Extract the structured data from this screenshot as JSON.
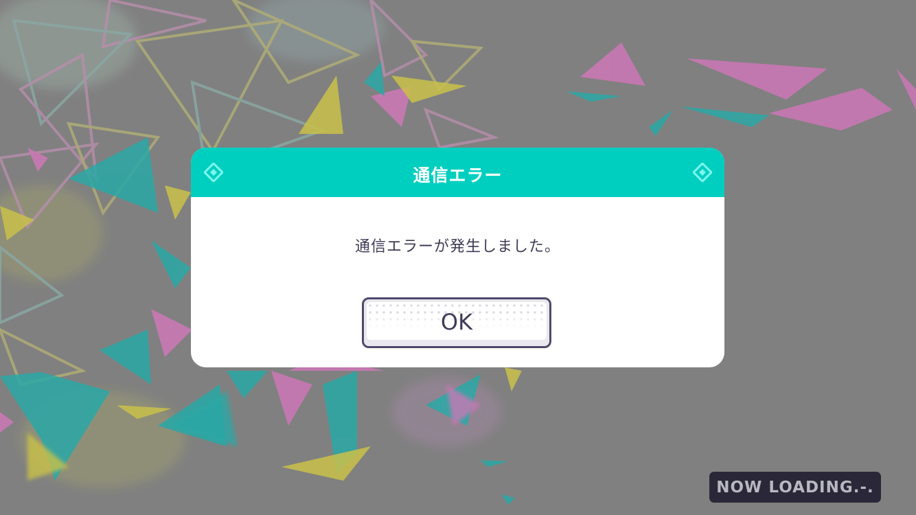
{
  "dialog": {
    "title": "通信エラー",
    "message": "通信エラーが発生しました。",
    "ok_label": "OK"
  },
  "loading": {
    "text": "NOW LOADING.-."
  },
  "colors": {
    "header": "#00cfc0",
    "dialog_text": "#3f3a55",
    "button_border": "#4e4a6a",
    "background_overlay": "#808080",
    "shard_pink": "#c978b3",
    "shard_teal": "#2aa8a6",
    "shard_yellow": "#c9c14a",
    "loading_badge": "#2a2838"
  }
}
